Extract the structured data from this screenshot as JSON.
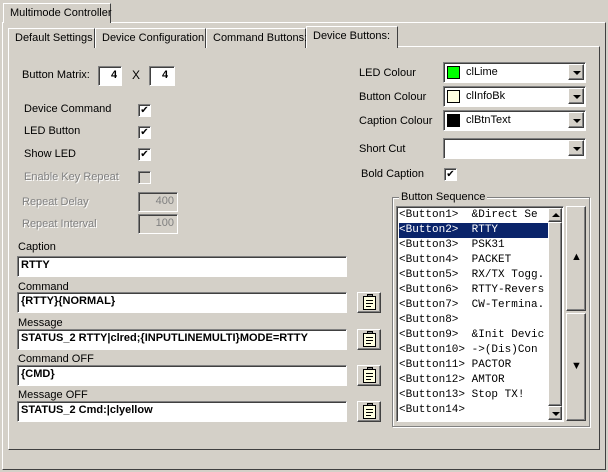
{
  "window_tab": "Multimode Controller",
  "tabs": [
    "Default Settings",
    "Device Configuration",
    "Command Buttons:",
    "Device Buttons:"
  ],
  "button_matrix": {
    "label": "Button Matrix:",
    "rows": "4",
    "x_symbol": "X",
    "cols": "4"
  },
  "checkboxes": {
    "device_command": {
      "label": "Device Command",
      "checked": "✔"
    },
    "led_button": {
      "label": "LED Button",
      "checked": "✔"
    },
    "show_led": {
      "label": "Show LED",
      "checked": "✔"
    },
    "enable_key_repeat": {
      "label": "Enable Key Repeat",
      "checked": ""
    }
  },
  "repeat_delay": {
    "label": "Repeat Delay",
    "value": "400"
  },
  "repeat_interval": {
    "label": "Repeat Interval",
    "value": "100"
  },
  "caption": {
    "label": "Caption",
    "value": "RTTY"
  },
  "command": {
    "label": "Command",
    "value": "{RTTY}{NORMAL}"
  },
  "message": {
    "label": "Message",
    "value": "STATUS_2 RTTY|clred;{INPUTLINEMULTI}MODE=RTTY"
  },
  "command_off": {
    "label": "Command OFF",
    "value": "{CMD}"
  },
  "message_off": {
    "label": "Message OFF",
    "value": "STATUS_2 Cmd:|clyellow"
  },
  "led_colour": {
    "label": "LED Colour",
    "value": "clLime",
    "color": "#00ff00"
  },
  "button_colour": {
    "label": "Button Colour",
    "value": "clInfoBk",
    "color": "#ffffe1"
  },
  "caption_colour": {
    "label": "Caption Colour",
    "value": "clBtnText",
    "color": "#000000"
  },
  "short_cut": {
    "label": "Short Cut",
    "value": ""
  },
  "bold_caption": {
    "label": "Bold Caption",
    "checked": "✔"
  },
  "button_sequence": {
    "label": "Button Sequence",
    "items": [
      "<Button1>  &Direct Se",
      "<Button2>  RTTY",
      "<Button3>  PSK31",
      "<Button4>  PACKET",
      "<Button5>  RX/TX Togg.",
      "<Button6>  RTTY-Revers",
      "<Button7>  CW-Termina.",
      "<Button8>",
      "<Button9>  &Init Devic",
      "<Button10> ->(Dis)Con",
      "<Button11> PACTOR",
      "<Button12> AMTOR",
      "<Button13> Stop TX!",
      "<Button14>"
    ],
    "selected_index": 1,
    "up_glyph": "▲",
    "down_glyph": "▼"
  }
}
